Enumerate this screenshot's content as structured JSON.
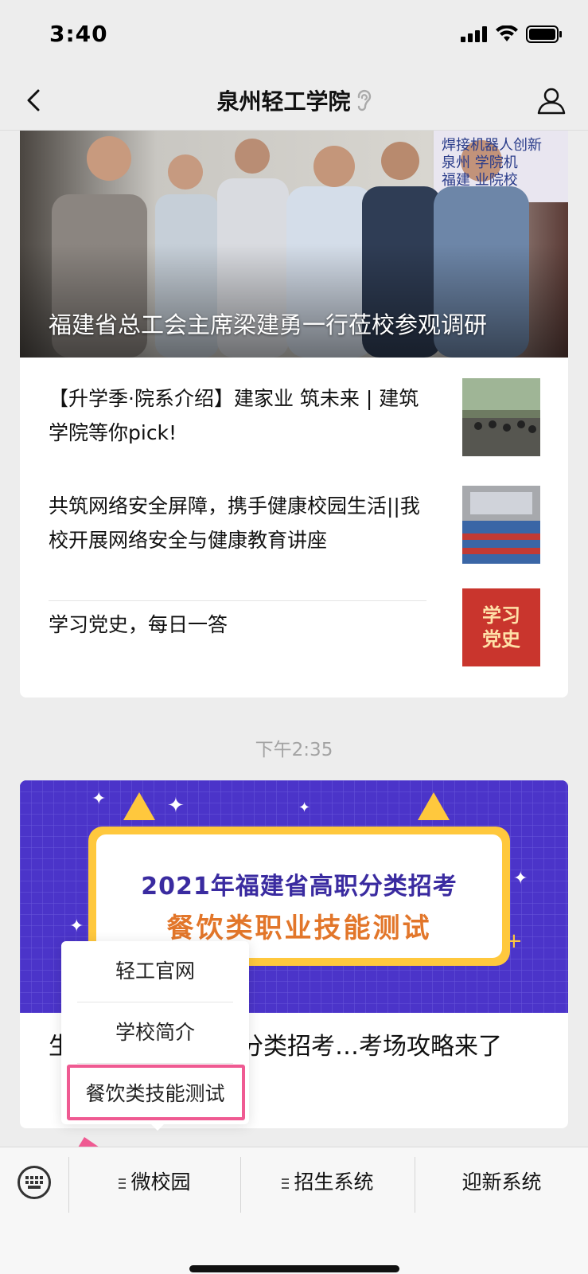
{
  "status_bar": {
    "time": "3:40"
  },
  "nav": {
    "title": "泉州轻工学院"
  },
  "featured": {
    "caption": "福建省总工会主席梁建勇一行莅校参观调研",
    "banner_text": "焊接机器人创新"
  },
  "articles": [
    {
      "title": "【升学季·院系介绍】建家业 筑未来 | 建筑学院等你pick!",
      "thumb_icon": "classroom-photo"
    },
    {
      "title": "共筑网络安全屏障，携手健康校园生活||我校开展网络安全与健康教育讲座",
      "thumb_icon": "lecture-hall-photo"
    },
    {
      "title": "学习党史，每日一答",
      "thumb_icon": "party-history-badge",
      "thumb_text": "学习\n党史"
    }
  ],
  "timestamp": "下午2:35",
  "promo": {
    "line1": "2021年福建省高职分类招考",
    "line2": "餐饮类职业技能测试",
    "title": "生注意！福建高职分类招考…考场攻略来了"
  },
  "popup_menu": {
    "items": [
      "轻工官网",
      "学校简介",
      "餐饮类技能测试"
    ],
    "highlighted_index": 2
  },
  "bottom_menu": {
    "items": [
      "微校园",
      "招生系统",
      "迎新系统"
    ]
  },
  "colors": {
    "promo_bg": "#4b34c9",
    "promo_accent": "#ffc83d",
    "highlight": "#ef5a92"
  }
}
